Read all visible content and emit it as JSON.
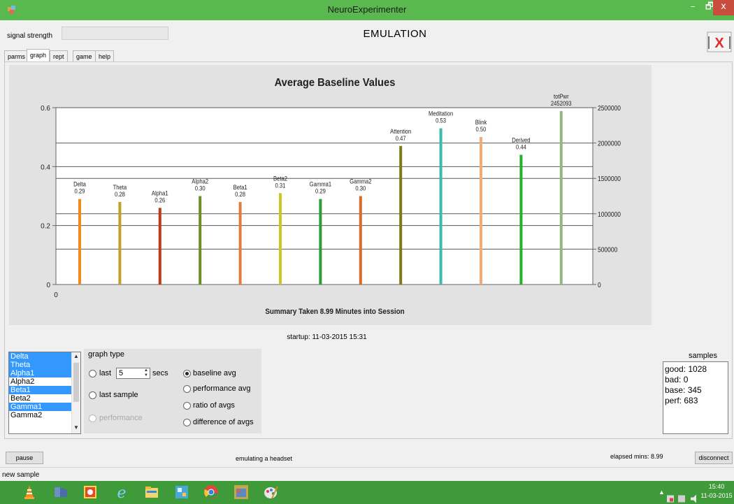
{
  "window": {
    "title": "NeuroExperimenter",
    "min_glyph": "–",
    "max_glyph": "🗗",
    "close_glyph": "x"
  },
  "header": {
    "signal_label": "signal strength",
    "mode": "EMULATION",
    "exit_glyph": "X"
  },
  "tabs": [
    {
      "label": "parms"
    },
    {
      "label": "graph"
    },
    {
      "label": "rept"
    },
    {
      "label": "game"
    },
    {
      "label": "help"
    }
  ],
  "chart_data": {
    "type": "bar",
    "title": "Average Baseline Values",
    "xlabel": "Summary Taken  8.99 Minutes into Session",
    "x_tick": "0",
    "left_axis": {
      "ticks": [
        "0.6",
        "0.4",
        "0.2",
        "0"
      ],
      "values": [
        0.6,
        0.4,
        0.2,
        0
      ],
      "ylim": [
        0,
        0.6
      ]
    },
    "right_axis": {
      "ticks": [
        "2500000",
        "2000000",
        "1500000",
        "1000000",
        "500000",
        "0"
      ],
      "values": [
        2500000,
        2000000,
        1500000,
        1000000,
        500000,
        0
      ],
      "ylim": [
        0,
        2500000
      ]
    },
    "grid": true,
    "bars": [
      {
        "name": "Delta",
        "label": "0.29",
        "value": 0.29,
        "axis": "left",
        "color": "#f08a1c"
      },
      {
        "name": "Theta",
        "label": "0.28",
        "value": 0.28,
        "axis": "left",
        "color": "#c2a028"
      },
      {
        "name": "Alpha1",
        "label": "0.26",
        "value": 0.26,
        "axis": "left",
        "color": "#c0391b"
      },
      {
        "name": "Alpha2",
        "label": "0.30",
        "value": 0.3,
        "axis": "left",
        "color": "#6d8e24"
      },
      {
        "name": "Beta1",
        "label": "0.28",
        "value": 0.28,
        "axis": "left",
        "color": "#e07c3e"
      },
      {
        "name": "Beta2",
        "label": "0.31",
        "value": 0.31,
        "axis": "left",
        "color": "#cbc824"
      },
      {
        "name": "Gamma1",
        "label": "0.29",
        "value": 0.29,
        "axis": "left",
        "color": "#2f9a3a"
      },
      {
        "name": "Gamma2",
        "label": "0.30",
        "value": 0.3,
        "axis": "left",
        "color": "#db6a2a"
      },
      {
        "name": "Attention",
        "label": "0.47",
        "value": 0.47,
        "axis": "left",
        "color": "#7e7c16"
      },
      {
        "name": "Meditation",
        "label": "0.53",
        "value": 0.53,
        "axis": "left",
        "color": "#3bbab0"
      },
      {
        "name": "Blink",
        "label": "0.50",
        "value": 0.5,
        "axis": "left",
        "color": "#f4a979"
      },
      {
        "name": "Derived",
        "label": "0.44",
        "value": 0.44,
        "axis": "left",
        "color": "#22b32a"
      },
      {
        "name": "totPwr",
        "label": "2452093",
        "value": 2452093,
        "axis": "right",
        "color": "#93b981"
      }
    ]
  },
  "startup": "startup: 11-03-2015 15:31",
  "channel_list": {
    "items": [
      {
        "label": "Delta",
        "selected": true
      },
      {
        "label": "Theta",
        "selected": true
      },
      {
        "label": "Alpha1",
        "selected": true
      },
      {
        "label": "Alpha2",
        "selected": false
      },
      {
        "label": "Beta1",
        "selected": true
      },
      {
        "label": "Beta2",
        "selected": false
      },
      {
        "label": "Gamma1",
        "selected": true
      },
      {
        "label": "Gamma2",
        "selected": false
      }
    ],
    "up_glyph": "▲",
    "down_glyph": "▼"
  },
  "graph_type": {
    "title": "graph type",
    "last_label": "last",
    "last_value": "5",
    "secs_label": "secs",
    "last_sample_label": "last sample",
    "performance_label": "performance",
    "baseline_avg_label": "baseline avg",
    "performance_avg_label": "performance avg",
    "ratio_label": "ratio of avgs",
    "difference_label": "difference of avgs",
    "spin_up": "▲",
    "spin_down": "▼"
  },
  "samples": {
    "title": "samples",
    "lines": [
      "good: 1028",
      "bad:  0",
      "base: 345",
      "perf: 683"
    ]
  },
  "footer": {
    "pause_label": "pause",
    "status": "emulating a headset",
    "elapsed": "elapsed mins: 8.99",
    "disconnect_label": "disconnect",
    "statusbar": "new sample"
  },
  "taskbar": {
    "icons": [
      "vlc-icon",
      "media-player-icon",
      "firewall-icon",
      "internet-explorer-icon",
      "file-explorer-icon",
      "control-panel-icon",
      "chrome-icon",
      "app-window-icon",
      "paint-icon"
    ],
    "tray": "▲",
    "time": "15:40",
    "date": "11-03-2015"
  },
  "colors": {
    "titlebar": "#59b94f",
    "taskbar": "#3f9a3a",
    "selection": "#3399ff",
    "close": "#c94c3c",
    "exit_x": "#e12b2b"
  }
}
